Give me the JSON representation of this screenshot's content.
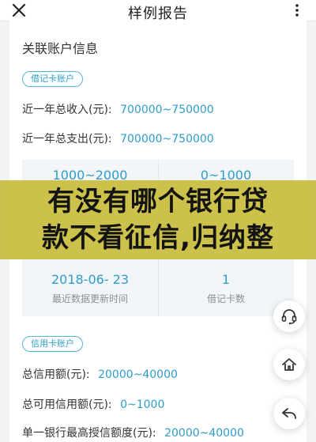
{
  "header": {
    "title": "样例报告",
    "close_icon": "close-icon",
    "more_icon": "more-vertical-icon"
  },
  "section": {
    "title": "关联账户信息"
  },
  "debit": {
    "pill": "借记卡账户",
    "income_label": "近一年总收入(元):",
    "income_value": "700000~750000",
    "expense_label": "近一年总支出(元):",
    "expense_value": "700000~750000",
    "stats": [
      {
        "value": "1000~2000",
        "label": ""
      },
      {
        "value": "0~1000",
        "label": ""
      },
      {
        "value": "2018-06- 23",
        "label": "最近数据更新时间"
      },
      {
        "value": "1",
        "label": "借记卡数"
      }
    ]
  },
  "banner": {
    "line1": "有没有哪个银行贷",
    "line2": "款不看征信,归纳整"
  },
  "credit": {
    "pill": "信用卡账户",
    "total_label": "总信用额(元):",
    "total_value": "20000~40000",
    "available_label": "总可用信用额(元):",
    "available_value": "0~1000",
    "max_label": "单一银行最高授信额度(元):",
    "max_value": "20000~40000"
  },
  "fabs": {
    "support_icon": "headset-icon",
    "home_icon": "home-icon",
    "share_icon": "share-back-icon"
  },
  "colors": {
    "accent": "#2f9ccb",
    "banner": "#c8bc3c"
  }
}
